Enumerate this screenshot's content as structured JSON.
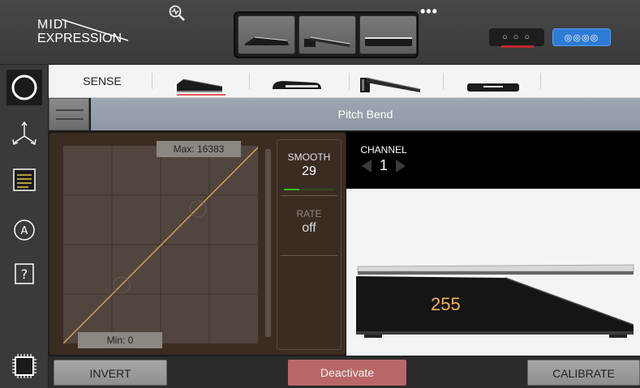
{
  "header": {
    "logo_line1": "MIDI",
    "logo_line2": "EXPRESSION",
    "search_icon": "pedal-search-icon",
    "presets": [
      {
        "icon": "flat-pedal-icon"
      },
      {
        "icon": "lever-pedal-icon"
      },
      {
        "icon": "wide-pedal-icon"
      }
    ],
    "more_label": "•••",
    "jack_a_label": "○ ○ ○",
    "jack_b_label": "◎◎◎◎"
  },
  "sidebar": {
    "items": [
      {
        "icon": "ring-icon",
        "active": true
      },
      {
        "icon": "routing-arrows-icon",
        "active": false
      },
      {
        "icon": "list-document-icon",
        "active": false
      },
      {
        "icon": "circled-a-icon",
        "active": false
      },
      {
        "icon": "question-icon",
        "active": false
      },
      {
        "icon": "chip-icon",
        "active": false
      }
    ],
    "question_label": "?",
    "a_label": "A"
  },
  "tabs": {
    "sense_label": "SENSE",
    "pedal_tabs": [
      {
        "icon": "ramp-pedal-icon",
        "selected": true
      },
      {
        "icon": "button-pedal-icon",
        "selected": false
      },
      {
        "icon": "sustain-pedal-icon",
        "selected": false
      },
      {
        "icon": "flat-switch-icon",
        "selected": false
      }
    ]
  },
  "mode": {
    "title": "Pitch Bend"
  },
  "curve": {
    "max_label": "Max: 16383",
    "min_label": "Min: 0"
  },
  "controls": {
    "smooth_label": "SMOOTH",
    "smooth_value": "29",
    "smooth_level": 0.3,
    "rate_label": "RATE",
    "rate_value": "off"
  },
  "channel": {
    "label": "CHANNEL",
    "value": "1"
  },
  "pedal": {
    "value": "255",
    "value_color": "#f0b25a"
  },
  "actions": {
    "invert_label": "INVERT",
    "deactivate_label": "Deactivate",
    "calibrate_label": "CALIBRATE"
  },
  "colors": {
    "accent_red": "#e25a5a",
    "deactivate": "#b96666",
    "blue_jack": "#2e7bd6",
    "curve_line": "#c9a063",
    "smooth_bar": "#3fb62a"
  }
}
